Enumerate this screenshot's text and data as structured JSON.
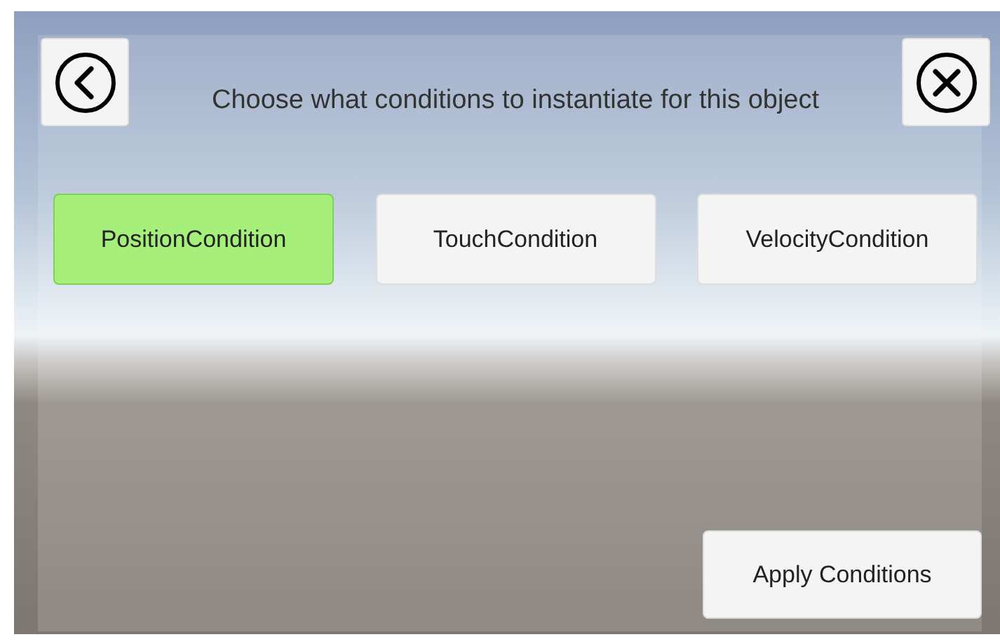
{
  "header": {
    "title": "Choose what conditions to instantiate for this object"
  },
  "conditions": [
    {
      "label": "PositionCondition",
      "selected": true
    },
    {
      "label": "TouchCondition",
      "selected": false
    },
    {
      "label": "VelocityCondition",
      "selected": false
    }
  ],
  "apply_button": {
    "label": "Apply Conditions"
  }
}
